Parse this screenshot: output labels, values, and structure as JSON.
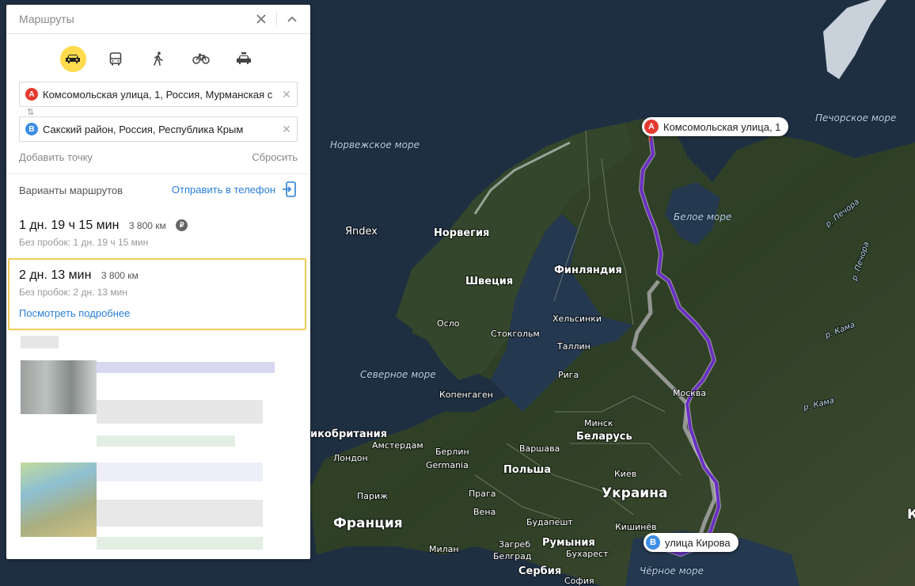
{
  "panel": {
    "title": "Маршруты",
    "close_icon": "close-icon",
    "collapse_icon": "chevron-up-icon",
    "modes": [
      {
        "name": "car",
        "icon": "car-icon",
        "active": true
      },
      {
        "name": "transit",
        "icon": "bus-icon",
        "active": false
      },
      {
        "name": "walk",
        "icon": "walk-icon",
        "active": false
      },
      {
        "name": "bike",
        "icon": "bicycle-icon",
        "active": false
      },
      {
        "name": "taxi",
        "icon": "taxi-icon",
        "active": false
      }
    ],
    "point_a": {
      "letter": "A",
      "value": "Комсомольская улица, 1, Россия, Мурманская с",
      "color": "#e5392e"
    },
    "point_b": {
      "letter": "B",
      "value": "Сакский район, Россия, Республика Крым",
      "color": "#3c8de3"
    },
    "add_point": "Добавить точку",
    "reset": "Сбросить",
    "variants_label": "Варианты маршрутов",
    "send_to_phone": "Отправить в телефон",
    "routes": [
      {
        "time": "1 дн. 19 ч 15 мин",
        "distance": "3 800 км",
        "no_traffic": "Без пробок: 1 дн. 19 ч 15 мин",
        "toll_badge": "₽"
      },
      {
        "time": "2 дн. 13 мин",
        "distance": "3 800 км",
        "no_traffic": "Без пробок: 2 дн. 13 мин",
        "details_link": "Посмотреть подробнее"
      }
    ]
  },
  "map": {
    "pin_a": {
      "letter": "A",
      "label": "Комсомольская улица, 1"
    },
    "pin_b": {
      "letter": "B",
      "label": "улица Кирова"
    },
    "watermark": "Яndex",
    "route_colors": {
      "main": "#6a2fc4",
      "alt": "#a6a6a6",
      "accent": "#ffdb4d"
    },
    "labels": {
      "norwegian_sea": "Норвежское море",
      "barents_sea": "Печорское море",
      "white_sea": "Белое море",
      "north_sea": "Северное море",
      "black_sea": "Чёрное море",
      "norway": "Норвегия",
      "sweden": "Швеция",
      "finland": "Финляндия",
      "belarus": "Беларусь",
      "poland": "Польша",
      "ukraine": "Украина",
      "france": "Франция",
      "romania": "Румыния",
      "serbia": "Сербия",
      "germany": "Germania",
      "uk": "икобритания",
      "oslo": "Осло",
      "stockholm": "Стокгольм",
      "helsinki": "Хельсинки",
      "tallinn": "Таллин",
      "riga": "Рига",
      "copenhagen": "Копенгаген",
      "moscow": "Москва",
      "minsk": "Минск",
      "warsaw": "Варшава",
      "berlin": "Берлин",
      "amsterdam": "Амстердам",
      "london": "Лондон",
      "paris": "Париж",
      "prague": "Прага",
      "vienna": "Вена",
      "kyiv": "Киев",
      "chisinau": "Кишинёв",
      "budapest": "Будапешт",
      "zagreb": "Загреб",
      "bucharest": "Бухарест",
      "belgrade": "Белград",
      "milan": "Милан",
      "sofia": "София",
      "river_pechora1": "р. Печора",
      "river_pechora2": "р. Печора",
      "river_kama1": "р. Кама",
      "river_kama2": "р. Кама",
      "edge_k": "К"
    }
  }
}
